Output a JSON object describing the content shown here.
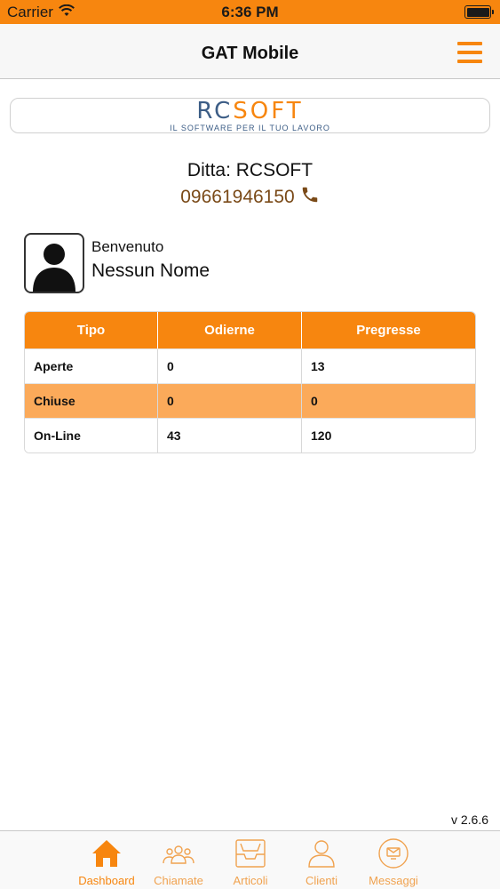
{
  "status_bar": {
    "carrier": "Carrier",
    "time": "6:36 PM"
  },
  "nav": {
    "title": "GAT Mobile"
  },
  "logo": {
    "brand_part1": "RC",
    "brand_part2": "SOFT",
    "tagline": "IL SOFTWARE PER IL TUO LAVORO"
  },
  "company": {
    "name": "Ditta: RCSOFT",
    "phone": "09661946150"
  },
  "user": {
    "welcome": "Benvenuto",
    "name": "Nessun Nome"
  },
  "table": {
    "headers": [
      "Tipo",
      "Odierne",
      "Pregresse"
    ],
    "rows": [
      [
        "Aperte",
        "0",
        "13"
      ],
      [
        "Chiuse",
        "0",
        "0"
      ],
      [
        "On-Line",
        "43",
        "120"
      ]
    ]
  },
  "version": "v 2.6.6",
  "tabs": [
    {
      "label": "Dashboard",
      "icon": "home-icon"
    },
    {
      "label": "Chiamate",
      "icon": "group-icon"
    },
    {
      "label": "Articoli",
      "icon": "inbox-icon"
    },
    {
      "label": "Clienti",
      "icon": "person-icon"
    },
    {
      "label": "Messaggi",
      "icon": "message-icon"
    }
  ],
  "colors": {
    "accent": "#f7860f",
    "row_highlight": "#fbaa5a",
    "phone": "#7a4a18",
    "logo_blue": "#3c5d86"
  }
}
